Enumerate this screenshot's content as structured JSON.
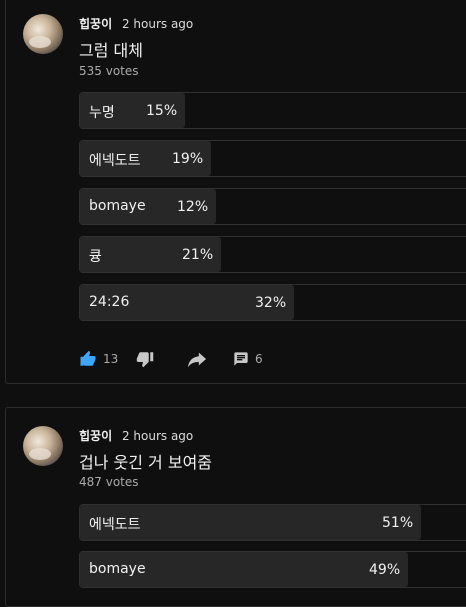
{
  "posts": [
    {
      "author": "힙꿍이",
      "time": "2 hours ago",
      "title": "그럼 대체",
      "votes": "535 votes",
      "options": [
        {
          "label": "누명",
          "percent": "15%",
          "fraction": 0.15
        },
        {
          "label": "에넥도트",
          "percent": "19%",
          "fraction": 0.19
        },
        {
          "label": "bomaye",
          "percent": "12%",
          "fraction": 0.12
        },
        {
          "label": "큥",
          "percent": "21%",
          "fraction": 0.21
        },
        {
          "label": "24:26",
          "percent": "32%",
          "fraction": 0.32
        }
      ],
      "actions": {
        "like_count": "13",
        "comment_count": "6"
      }
    },
    {
      "author": "힙꿍이",
      "time": "2 hours ago",
      "title": "겁나 웃긴 거 보여줌",
      "votes": "487 votes",
      "options": [
        {
          "label": "에넥도트",
          "percent": "51%",
          "fraction": 0.51
        },
        {
          "label": "bomaye",
          "percent": "49%",
          "fraction": 0.49
        }
      ]
    }
  ],
  "colors": {
    "accent_like": "#3ea6ff",
    "background": "#0f0f0f",
    "option_fill": "#272727"
  },
  "icons": [
    "like-icon",
    "dislike-icon",
    "share-icon",
    "comment-icon"
  ]
}
